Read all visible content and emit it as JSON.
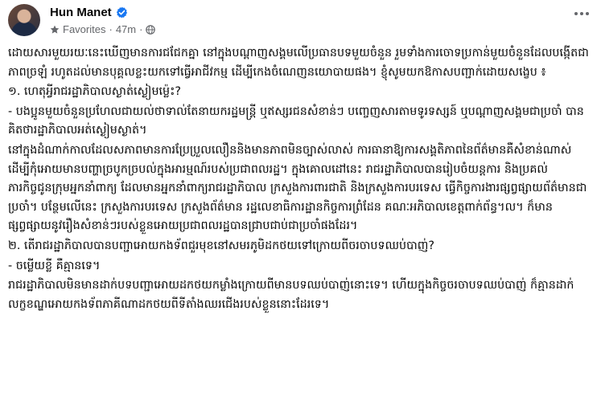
{
  "post": {
    "author": "Hun Manet",
    "verified_icon": "verified-badge-icon",
    "audience_label": "Favorites",
    "audience_icon": "star-icon",
    "separator": "·",
    "time": "47m",
    "privacy_icon": "globe-icon",
    "more_icon": "more-options-icon",
    "accent_color": "#1877f2",
    "meta_color": "#65676b",
    "paragraphs": [
      "ដោយសារមួយរយៈនេះឃើញមានការជជែកគ្នា នៅក្នុងបណ្ដាញសង្គមលើប្រធានបទមួយចំនួន រួមទាំងការចោទប្រកាន់មួយចំនួនដែលបង្កើតជាភាពច្រឡំ រហូតដល់មានបុគ្គលខ្លះយកទៅធ្វើអាជីវកម្ម ដើម្បីកេងចំណេញនយោបាយផង។ ខ្ញុំសូមយកឱកាសបញ្ជាក់ដោយសង្ខេប ៖",
      "១. ហេតុអ្វីរាជរដ្ឋាភិបាលស្ងាត់ស្ងៀមម្ល៉េះ?",
      "- បងប្អូនមួយចំនួនប្រហែលជាយល់ថាទាល់តែនាយករដ្ឋមន្ត្រី ឬឥស្សរជនសំខាន់ៗ បញ្ចេញសារតាមទូរទស្សន៍ ឬបណ្ដាញសង្គមជាប្រចាំ បានគិតថារដ្ឋាភិបាលអត់ស្ងៀមស្ងាត់។",
      "នៅក្នុងដំណាក់កាលដែលសភាពមានការប្រែប្រួលលឿននិងមានភាពមិនច្បាស់លាស់ ការធានាឱ្យការសង្គតិភាពនៃព័ត៌មានគឺសំខាន់ណាស់ ដើម្បីកុំអោយមានបញ្ហាច្របូកច្របល់ក្នុងអារម្មណ៍របស់ប្រជាពលរដ្ឋ។ ក្នុងគោលដៅនេះ រាជរដ្ឋាភិបាលបានរៀបចំយន្តការ និងប្រគល់ភារកិច្ចជូនក្រុមអ្នកនាំពាក្យ ដែលមានអ្នកនាំពាក្យរាជរដ្ឋាភិបាល ក្រសួងការពារជាតិ និងក្រសួងការបរទេស ធ្វើកិច្ចការងារផ្សព្វផ្សាយព័ត៌មានជាប្រចាំ។ បន្ថែមលើនេះ ក្រសួងការបរទេស ក្រសួងព័ត៌មាន រដ្ឋលេខាធិការដ្ឋានកិច្ចការព្រំដែន គណៈអភិបាលខេត្តពាក់ព័ន្ធ។ល។ ក៏មានផ្សព្វផ្សាយនូវរឿងសំខាន់ៗរបស់ខ្លួនអោយប្រជាពលរដ្ឋបានជ្រាបជាប់ជាប្រចាំផងដែរ។",
      "២. តើរាជរដ្ឋាភិបាលបានបញ្ជាអោយកងទ័ពជួរមុខនៅសមរភូមិដកថយទៅក្រោយពីចរចាបទឈប់បាញ់?",
      "- ចម្លើយខ្លី គឺគ្មានទេ។",
      "រាជរដ្ឋាភិបាលមិនមានដាក់បទបញ្ជាអោយដកថយកម្លាំងក្រោយពីមានបទឈប់បាញ់នោះទេ។ ហើយក្នុងកិច្ចចរចាបទឈប់បាញ់ ក៏គ្មានដាក់លក្ខខណ្ឌអោយកងទ័ពភាគីណាដកថយពីទីតាំងឈរជើងរបស់ខ្លួននោះដែរទេ។"
    ]
  }
}
